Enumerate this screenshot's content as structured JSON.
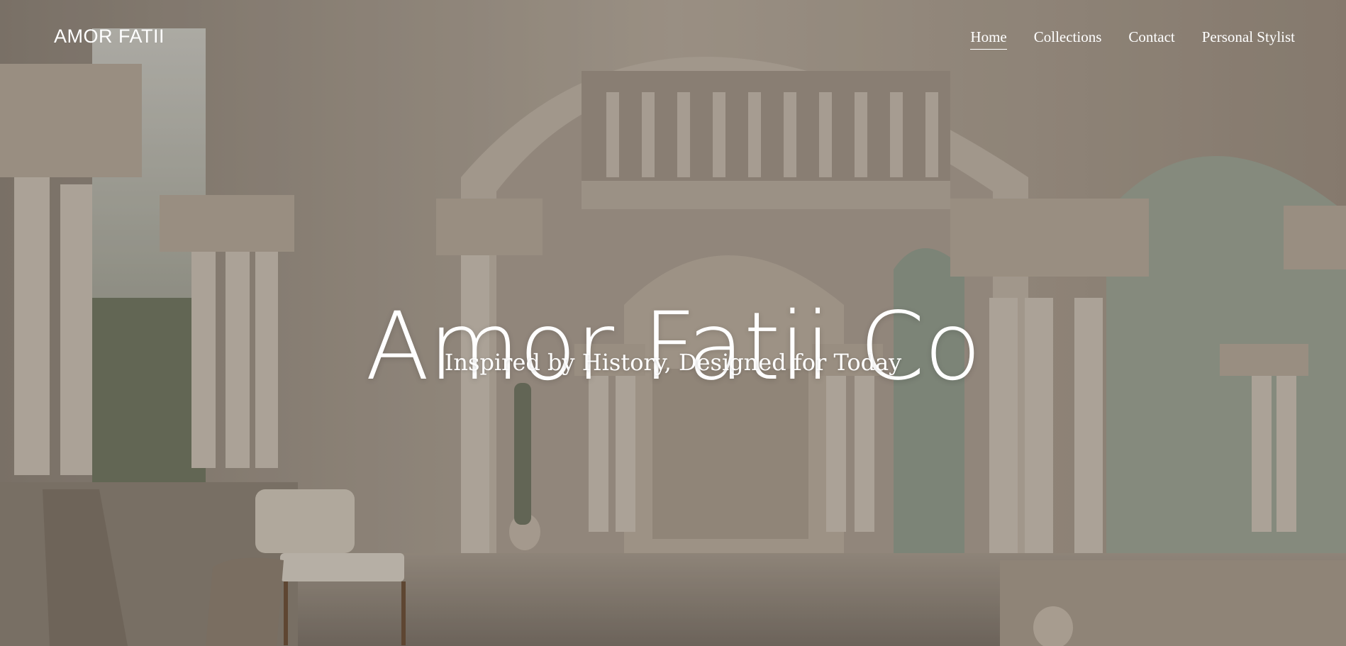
{
  "brand": {
    "logo": "AMOR FATII"
  },
  "nav": {
    "items": [
      {
        "label": "Home",
        "active": true
      },
      {
        "label": "Collections",
        "active": false
      },
      {
        "label": "Contact",
        "active": false
      },
      {
        "label": "Personal Stylist",
        "active": false
      }
    ]
  },
  "hero": {
    "title": "Amor Fatii Co",
    "subtitle": "Inspired by History, Designed for Today",
    "image_description_icon": "cloister-arches-image"
  },
  "colors": {
    "stone": "#b9ada0",
    "shadow": "#6e665c",
    "sage": "#8f9a8a",
    "text": "#ffffff"
  }
}
